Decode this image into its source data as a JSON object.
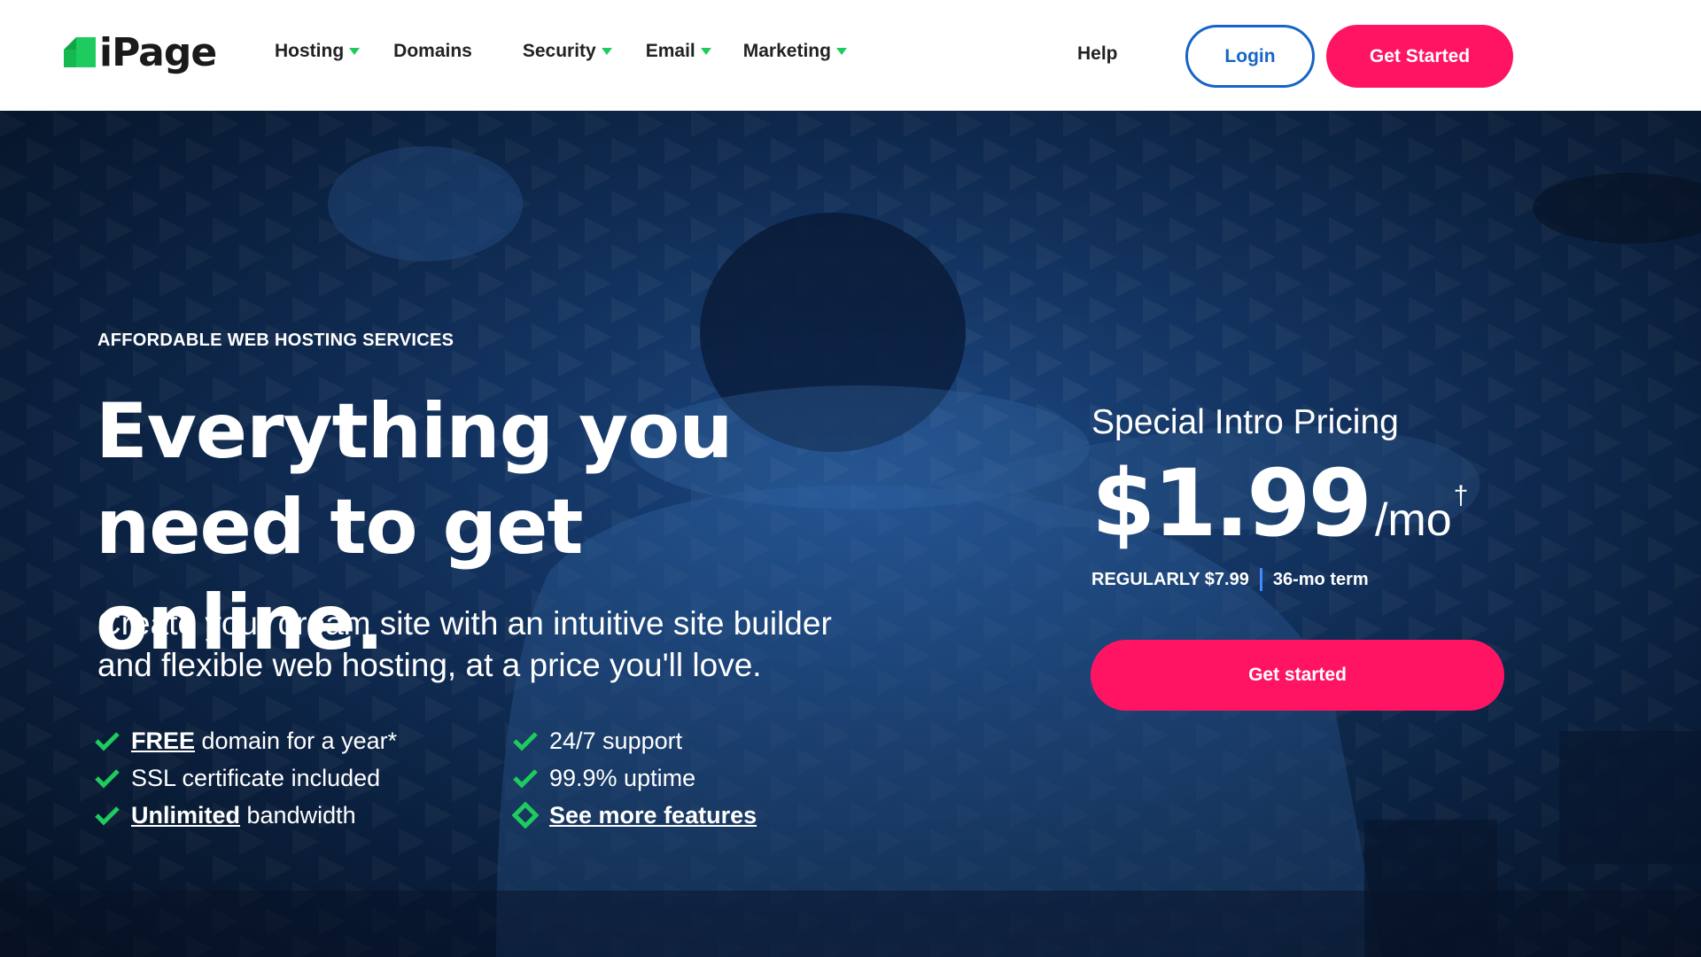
{
  "brand": {
    "name": "iPage",
    "logo_color": "#1ecb5e"
  },
  "nav": {
    "items": [
      {
        "label": "Hosting",
        "has_dropdown": true
      },
      {
        "label": "Domains",
        "has_dropdown": false
      },
      {
        "label": "Security",
        "has_dropdown": true
      },
      {
        "label": "Email",
        "has_dropdown": true
      },
      {
        "label": "Marketing",
        "has_dropdown": true
      }
    ],
    "help": "Help",
    "login": "Login",
    "get_started": "Get Started"
  },
  "hero": {
    "eyebrow": "AFFORDABLE WEB HOSTING SERVICES",
    "headline_line1": "Everything you",
    "headline_line2": "need to get online.",
    "subtext_line1": "Create your dream site with an intuitive site builder",
    "subtext_line2": "and flexible web hosting, at a price you'll love.",
    "features": [
      {
        "strong": "FREE",
        "text": " domain for a year*",
        "icon": "check-icon"
      },
      {
        "strong": "",
        "text": "24/7 support",
        "icon": "check-icon"
      },
      {
        "strong": "",
        "text": "SSL certificate included",
        "icon": "check-icon"
      },
      {
        "strong": "",
        "text": "99.9% uptime",
        "icon": "check-icon"
      },
      {
        "strong": "Unlimited",
        "text": " bandwidth",
        "icon": "check-icon"
      },
      {
        "strong": "See more features",
        "text": "",
        "icon": "diamond-icon"
      }
    ]
  },
  "pricing": {
    "label": "Special Intro Pricing",
    "price": "$1.99",
    "per": "/mo",
    "dagger": "†",
    "regular": "REGULARLY $7.99",
    "term": "36-mo term",
    "cta": "Get started"
  },
  "colors": {
    "accent_pink": "#ff1464",
    "accent_blue": "#1664c8",
    "check_green": "#1ecb5e",
    "hero_bg": "#153a6e"
  }
}
